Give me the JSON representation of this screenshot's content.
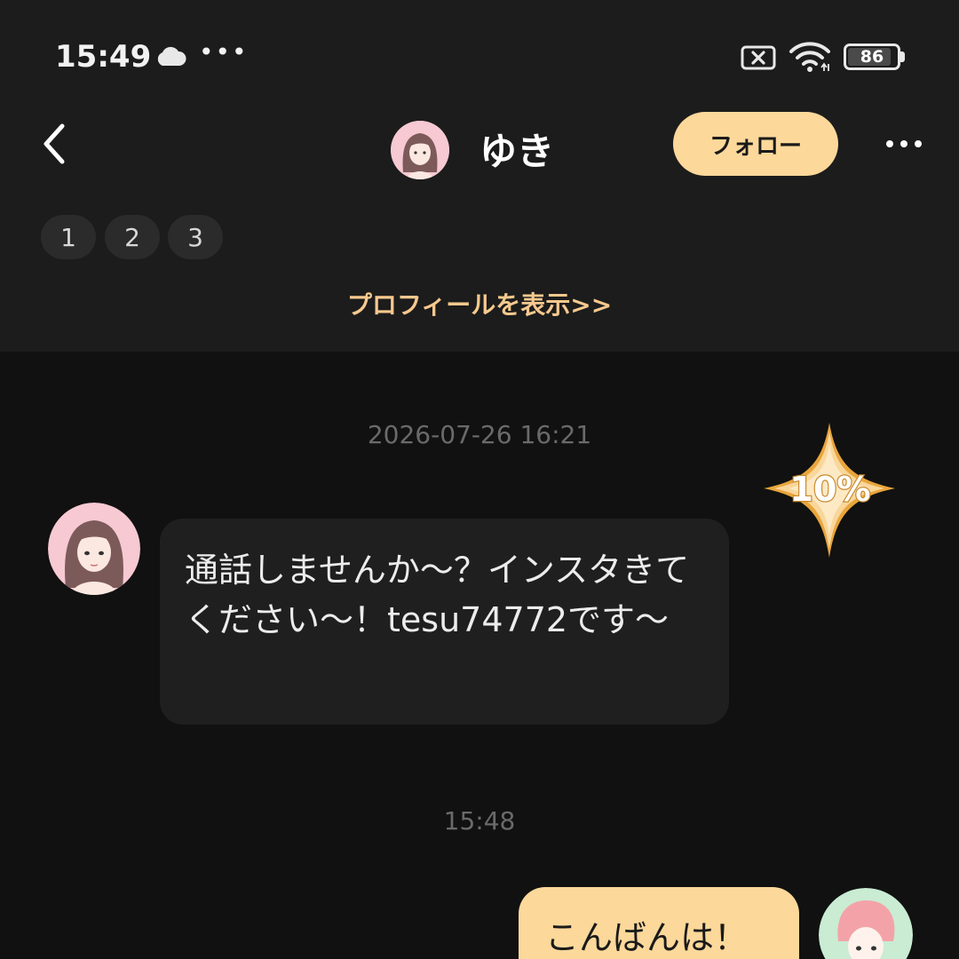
{
  "status_bar": {
    "time": "15:49",
    "overflow": "•••",
    "battery_level": "86",
    "icons": [
      "cloud-icon",
      "sim-error-icon",
      "wifi-icon",
      "battery-icon"
    ]
  },
  "header": {
    "back_icon": "chevron-left-icon",
    "name": "ゆき",
    "follow_label": "フォロー",
    "more_icon": "more-horizontal-icon"
  },
  "pills": [
    "1",
    "2",
    "3"
  ],
  "profile_link": "プロフィールを表示>>",
  "chat": {
    "timestamp_1": "2026-07-26 16:21",
    "badge_text": "10%",
    "incoming_message": "通話しませんか〜？インスタきてください〜！tesu74772です〜",
    "timestamp_2": "15:48",
    "outgoing_message": "こんばんは！"
  },
  "colors": {
    "accent": "#fcd89a",
    "link": "#f6c98e",
    "header_bg": "#1c1c1c",
    "chat_bg": "#111111",
    "bubble_bg": "#1f1f1f"
  }
}
